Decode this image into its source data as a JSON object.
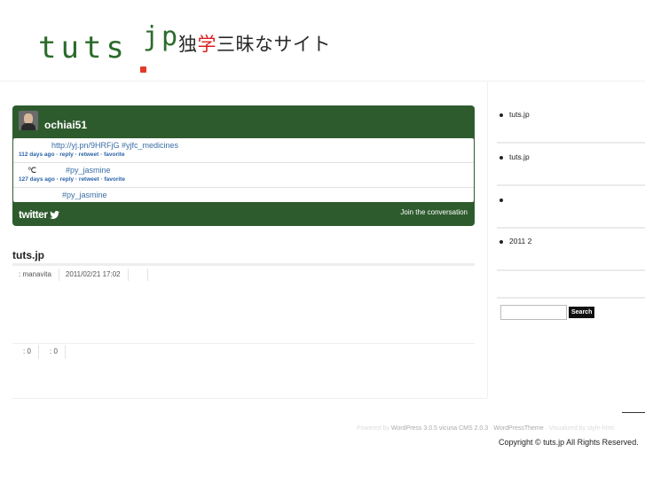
{
  "header": {
    "logo_tuts": "tuts",
    "logo_jp": "jp",
    "tagline_a": "独",
    "tagline_b": "学",
    "tagline_c": "三昧なサイト"
  },
  "twitter": {
    "username": "ochiai51",
    "tweets": [
      {
        "text": "http://yj.pn/9HRFjG #yjfc_medicines",
        "meta": "112 days ago · reply · retweet · favorite"
      },
      {
        "text_prefix": "℃",
        "text": "#py_jasmine",
        "meta": "127 days ago · reply · retweet · favorite"
      },
      {
        "text": "#py_jasmine",
        "meta": ""
      }
    ],
    "logo_label": "twitter",
    "join_label": "Join the conversation"
  },
  "post": {
    "title": "tuts.jp",
    "author": ": manavita",
    "date": "2011/02/21 17:02",
    "count1": ": 0",
    "count2": ": 0"
  },
  "sidebar": {
    "items": [
      "tuts.jp",
      "tuts.jp",
      "",
      "2011 2"
    ],
    "search_placeholder": "",
    "search_button": "Search"
  },
  "footer": {
    "powered_prefix": "Powered by",
    "wordpress": "WordPress 3.0.5",
    "cms": "vicuna CMS 2.0.3",
    "theme": "WordPressTheme",
    "visualized": "· Visualized by",
    "stylehtml": "style-html",
    "copyright": "Copyright © tuts.jp All Rights Reserved."
  }
}
